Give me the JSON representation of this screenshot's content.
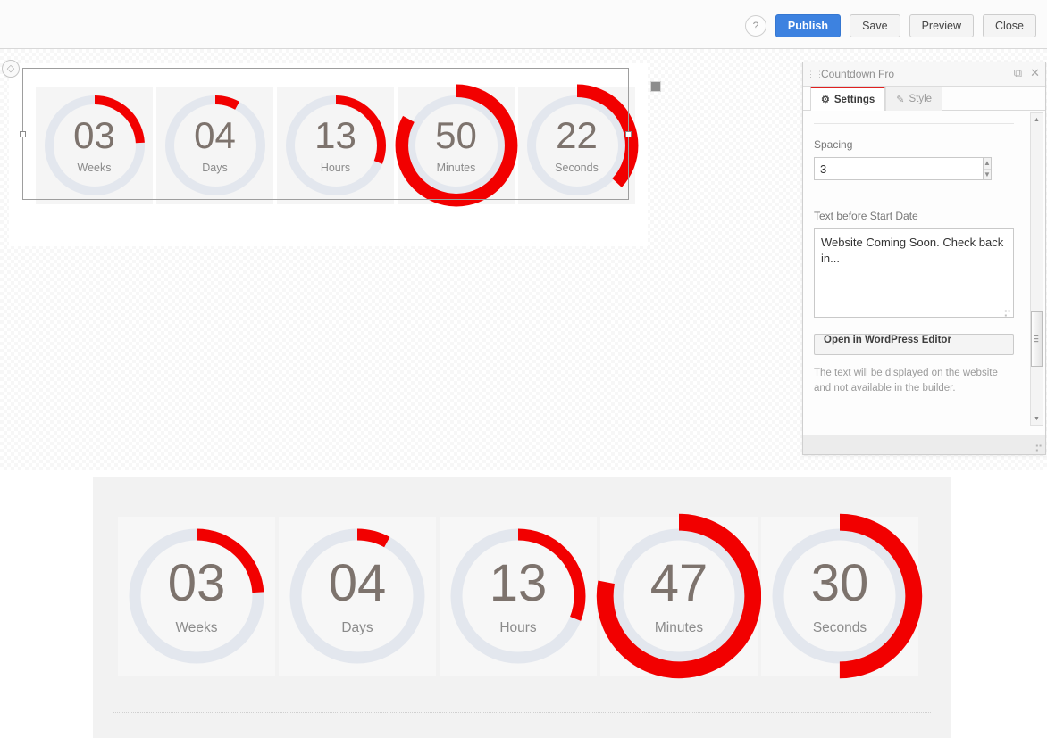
{
  "toolbar": {
    "help_label": "?",
    "publish_label": "Publish",
    "save_label": "Save",
    "preview_label": "Preview",
    "close_label": "Close",
    "publish_color": "#3d82e0"
  },
  "panel": {
    "title": "Countdown Fro",
    "restore_icon": "⧉",
    "close_icon": "✕",
    "tabs": [
      {
        "label": "Settings",
        "icon": "⚙",
        "active": true
      },
      {
        "label": "Style",
        "icon": "✎",
        "active": false
      }
    ],
    "spacing": {
      "label": "Spacing",
      "value": "3",
      "up_icon": "▲",
      "down_icon": "▼"
    },
    "text_before": {
      "label": "Text before Start Date",
      "value": "Website Coming Soon. Check back in..."
    },
    "wp_button_label": "Open in WordPress Editor",
    "hint": "The text will be displayed on the website and not available in the builder.",
    "scroll_up_icon": "▲",
    "scroll_down_icon": "▼",
    "accent_color": "#e02020"
  },
  "countdown": {
    "track_color": "#e3e7ee",
    "arc_color": "#f20000",
    "number_color": "#7d736d",
    "label_color": "#8b8b8b",
    "editor": {
      "units": [
        {
          "value": "03",
          "label": "Weeks",
          "percent": 24,
          "oversize": false
        },
        {
          "value": "04",
          "label": "Days",
          "percent": 8,
          "oversize": false
        },
        {
          "value": "13",
          "label": "Hours",
          "percent": 31,
          "oversize": false
        },
        {
          "value": "50",
          "label": "Minutes",
          "percent": 83,
          "oversize": true
        },
        {
          "value": "22",
          "label": "Seconds",
          "percent": 37,
          "oversize": true
        }
      ]
    },
    "preview": {
      "units": [
        {
          "value": "03",
          "label": "Weeks",
          "percent": 24,
          "oversize": false
        },
        {
          "value": "04",
          "label": "Days",
          "percent": 8,
          "oversize": false
        },
        {
          "value": "13",
          "label": "Hours",
          "percent": 31,
          "oversize": false
        },
        {
          "value": "47",
          "label": "Minutes",
          "percent": 78,
          "oversize": true
        },
        {
          "value": "30",
          "label": "Seconds",
          "percent": 50,
          "oversize": true
        }
      ]
    }
  }
}
